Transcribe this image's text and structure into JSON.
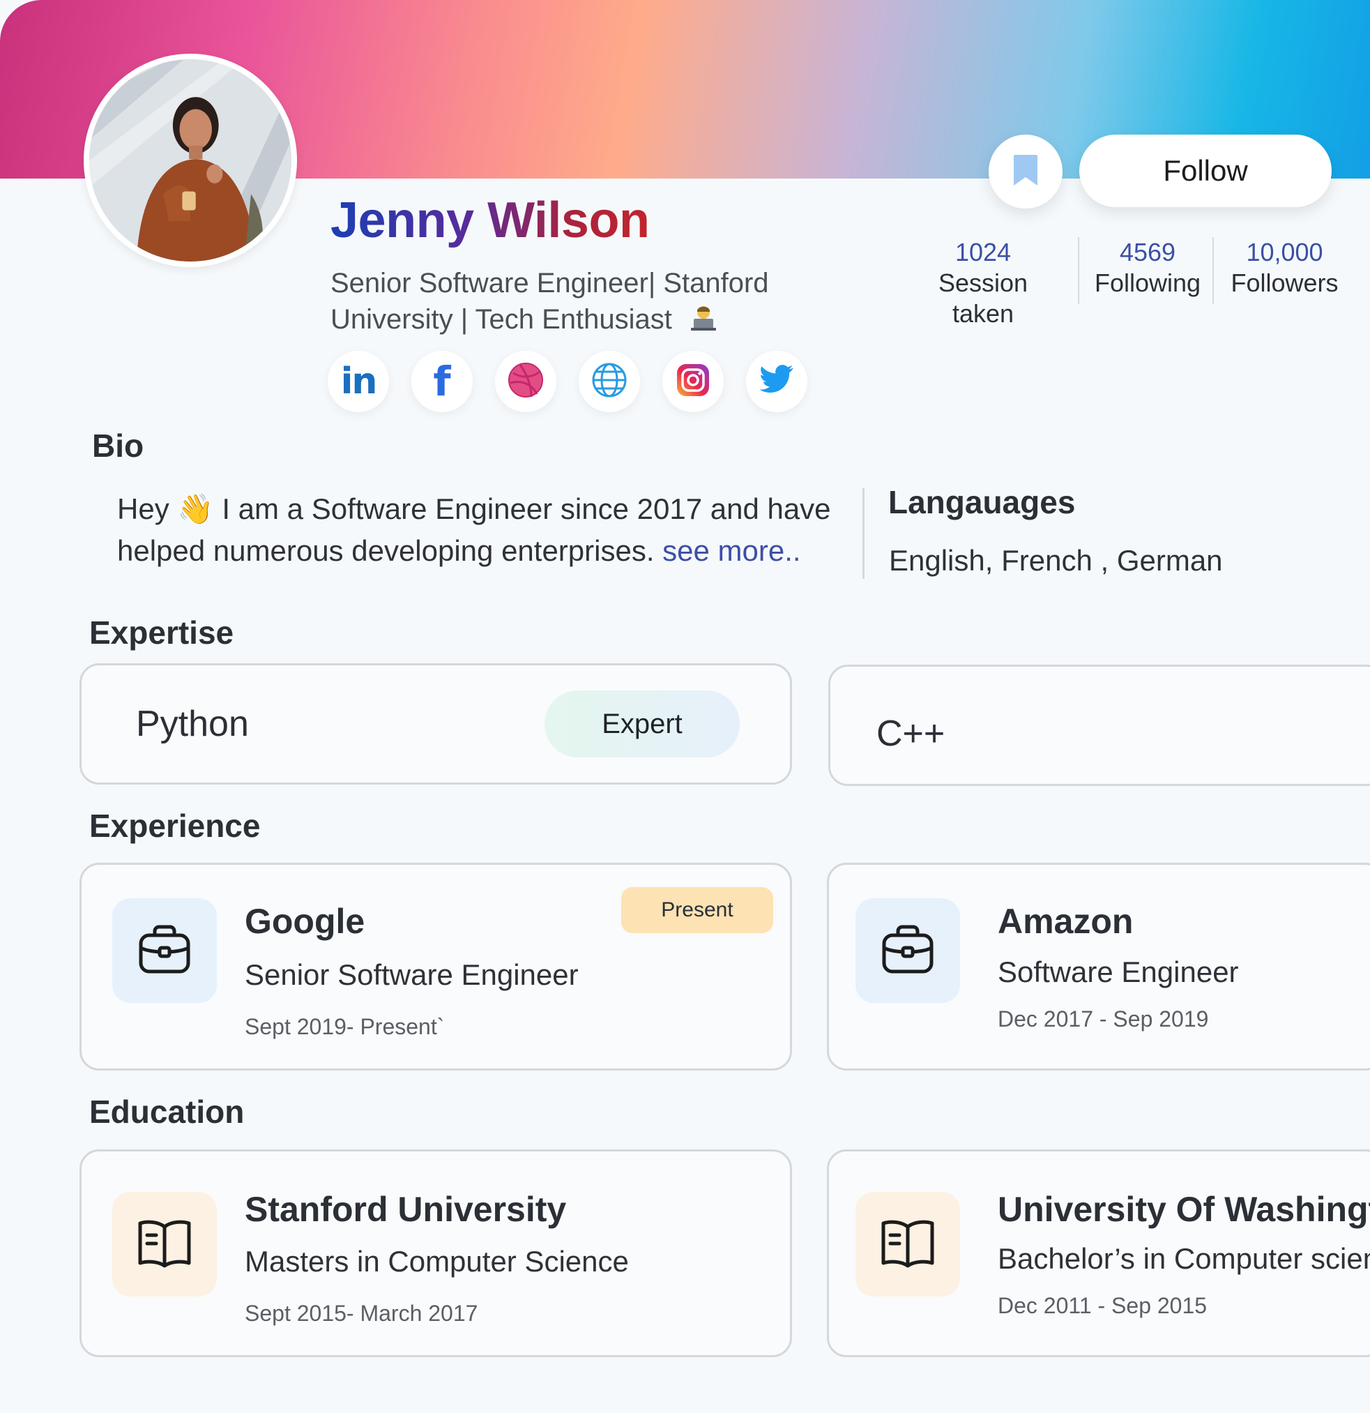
{
  "profile": {
    "name": "Jenny Wilson",
    "headline": "Senior Software Engineer| Stanford University | Tech Enthusiast",
    "headline_emoji": "technologist-icon"
  },
  "actions": {
    "follow_label": "Follow",
    "save_icon": "bookmark-icon"
  },
  "stats": [
    {
      "value": "1024",
      "label": "Session taken"
    },
    {
      "value": "4569",
      "label": "Following"
    },
    {
      "value": "10,000",
      "label": "Followers"
    }
  ],
  "socials": [
    "linkedin-icon",
    "facebook-icon",
    "dribbble-icon",
    "globe-icon",
    "instagram-icon",
    "twitter-icon"
  ],
  "bio": {
    "title": "Bio",
    "text": "Hey 👋 I am a Software Engineer since 2017 and have helped numerous developing enterprises.",
    "see_more": "see more.."
  },
  "languages": {
    "title": "Langauages",
    "text": "English, French , German"
  },
  "expertise": {
    "title": "Expertise",
    "items": [
      {
        "skill": "Python",
        "level": "Expert"
      },
      {
        "skill": "C++",
        "level": ""
      }
    ]
  },
  "experience": {
    "title": "Experience",
    "items": [
      {
        "company": "Google",
        "role": "Senior Software Engineer",
        "dates": "Sept 2019- Present`",
        "badge": "Present"
      },
      {
        "company": "Amazon",
        "role": "Software Engineer",
        "dates": "Dec 2017 - Sep 2019",
        "badge": ""
      }
    ]
  },
  "education": {
    "title": "Education",
    "items": [
      {
        "school": "Stanford University",
        "degree": "Masters in Computer Science",
        "dates": "Sept 2015- March 2017"
      },
      {
        "school": "University Of Washington",
        "degree": "Bachelor’s in Computer science",
        "dates": "Dec 2011 - Sep 2015"
      }
    ]
  },
  "colors": {
    "accent_blue": "#3b4fa6",
    "present_badge": "#fde2b4",
    "briefcase_tile": "#e6f1fc",
    "book_tile": "#fdf1e4"
  }
}
